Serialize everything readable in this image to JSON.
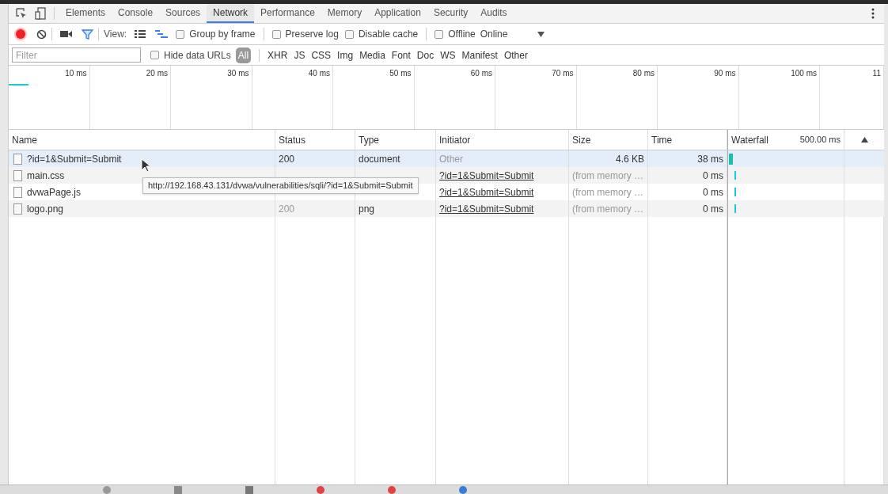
{
  "tabs": [
    {
      "label": "Elements",
      "selected": false
    },
    {
      "label": "Console",
      "selected": false
    },
    {
      "label": "Sources",
      "selected": false
    },
    {
      "label": "Network",
      "selected": true
    },
    {
      "label": "Performance",
      "selected": false
    },
    {
      "label": "Memory",
      "selected": false
    },
    {
      "label": "Application",
      "selected": false
    },
    {
      "label": "Security",
      "selected": false
    },
    {
      "label": "Audits",
      "selected": false
    }
  ],
  "toolbar": {
    "recording": true,
    "view_label": "View:",
    "group_by_frame": {
      "label": "Group by frame",
      "checked": false
    },
    "preserve_log": {
      "label": "Preserve log",
      "checked": false
    },
    "disable_cache": {
      "label": "Disable cache",
      "checked": false
    },
    "offline": {
      "label": "Offline",
      "checked": false
    },
    "throttling": "Online"
  },
  "filter_bar": {
    "placeholder": "Filter",
    "hide_data_urls": {
      "label": "Hide data URLs",
      "checked": false
    },
    "types": [
      {
        "label": "All",
        "selected": true
      },
      {
        "label": "XHR",
        "selected": false
      },
      {
        "label": "JS",
        "selected": false
      },
      {
        "label": "CSS",
        "selected": false
      },
      {
        "label": "Img",
        "selected": false
      },
      {
        "label": "Media",
        "selected": false
      },
      {
        "label": "Font",
        "selected": false
      },
      {
        "label": "Doc",
        "selected": false
      },
      {
        "label": "WS",
        "selected": false
      },
      {
        "label": "Manifest",
        "selected": false
      },
      {
        "label": "Other",
        "selected": false
      }
    ]
  },
  "overview_ticks": [
    "10 ms",
    "20 ms",
    "30 ms",
    "40 ms",
    "50 ms",
    "60 ms",
    "70 ms",
    "80 ms",
    "90 ms",
    "100 ms",
    "11"
  ],
  "table": {
    "columns": [
      "Name",
      "Status",
      "Type",
      "Initiator",
      "Size",
      "Time",
      "Waterfall"
    ],
    "waterfall_scale": "500.00 ms",
    "rows": [
      {
        "name": "?id=1&Submit=Submit",
        "status": "200",
        "type": "document",
        "initiator": "Other",
        "size": "4.6 KB",
        "time": "38 ms",
        "selected": true,
        "cached": false
      },
      {
        "name": "main.css",
        "initiator": "?id=1&Submit=Submit",
        "size": "(from memory …",
        "time": "0 ms",
        "selected": false,
        "cached": true
      },
      {
        "name": "dvwaPage.js",
        "initiator": "?id=1&Submit=Submit",
        "size": "(from memory …",
        "time": "0 ms",
        "selected": false,
        "cached": true
      },
      {
        "name": "logo.png",
        "status": "200",
        "type": "png",
        "initiator": "?id=1&Submit=Submit",
        "size": "(from memory …",
        "time": "0 ms",
        "selected": false,
        "cached": true
      }
    ]
  },
  "tooltip": "http://192.168.43.131/dvwa/vulnerabilities/sqli/?id=1&Submit=Submit"
}
